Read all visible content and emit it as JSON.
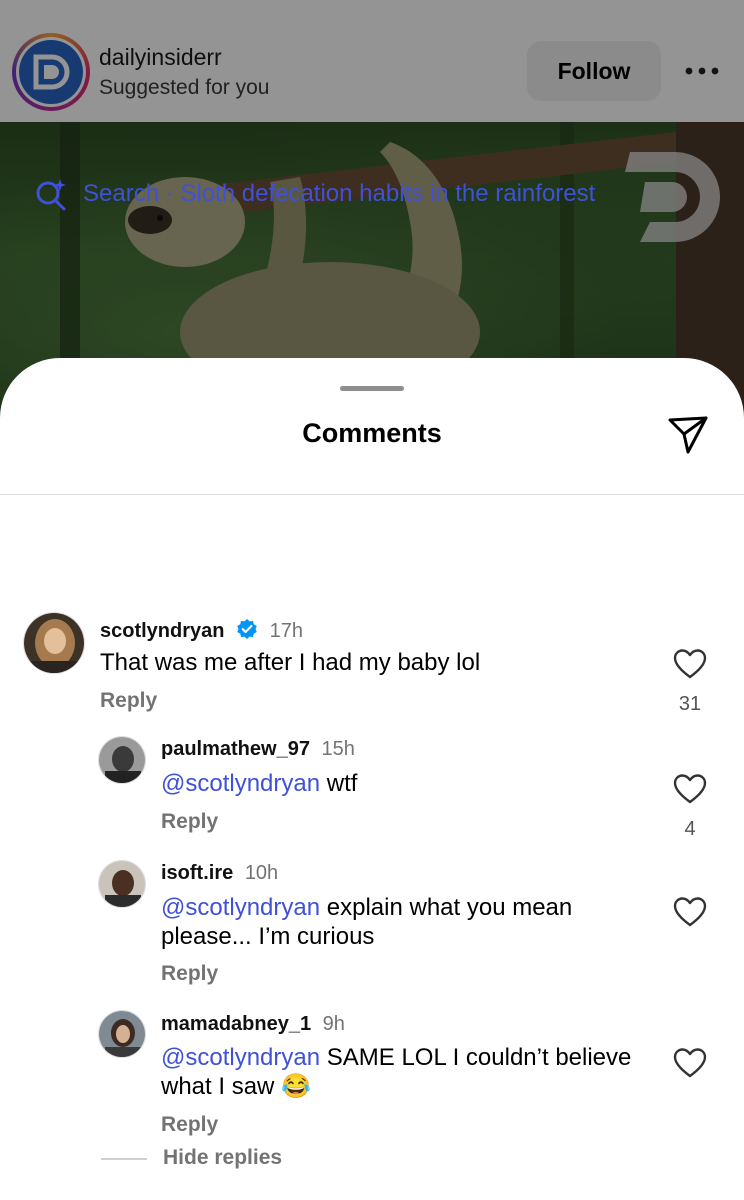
{
  "post": {
    "username": "dailyinsiderr",
    "subtitle": "Suggested for you",
    "follow_label": "Follow",
    "more_icon": "more-horizontal-icon"
  },
  "sheet": {
    "title": "Comments",
    "share_icon": "send-icon"
  },
  "search": {
    "icon": "sparkle-search-icon",
    "text": "Search · Sloth defecation habits in the rainforest"
  },
  "comments": [
    {
      "username": "scotlyndryan",
      "verified": true,
      "time": "17h",
      "text": "That was me after I had my baby lol",
      "reply_label": "Reply",
      "likes": "31"
    }
  ],
  "replies": [
    {
      "username": "paulmathew_97",
      "time": "15h",
      "mention": "@scotlyndryan",
      "text": " wtf",
      "reply_label": "Reply",
      "likes": "4"
    },
    {
      "username": "isoft.ire",
      "time": "10h",
      "mention": "@scotlyndryan",
      "text": " explain what you mean please... I’m curious",
      "reply_label": "Reply"
    },
    {
      "username": "mamadabney_1",
      "time": "9h",
      "mention": "@scotlyndryan",
      "text": " SAME LOL I couldn’t believe what I saw 😂",
      "reply_label": "Reply"
    }
  ],
  "hide_replies_label": "Hide replies",
  "colors": {
    "mention": "#3f51d8",
    "muted": "#737373",
    "verified": "#0095f6"
  }
}
